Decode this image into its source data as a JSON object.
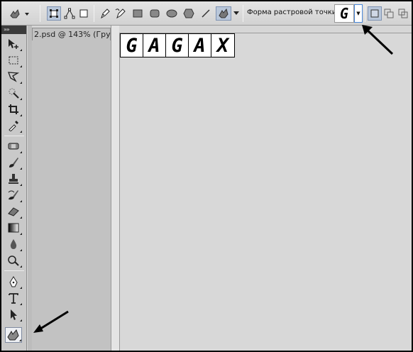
{
  "options_bar": {
    "shape_label": "Форма растровой точки:",
    "shape_preview": "G",
    "dropdown_glyph": "▼"
  },
  "toolbox": {
    "collapse_glyph": "»»"
  },
  "document": {
    "tab_title": "2.psd @ 143% (Гру"
  },
  "canvas": {
    "glyphs": [
      "G",
      "A",
      "G",
      "A",
      "X"
    ]
  },
  "colors": {
    "selected_highlight": "#b9c7da",
    "arrow": "#000000"
  }
}
